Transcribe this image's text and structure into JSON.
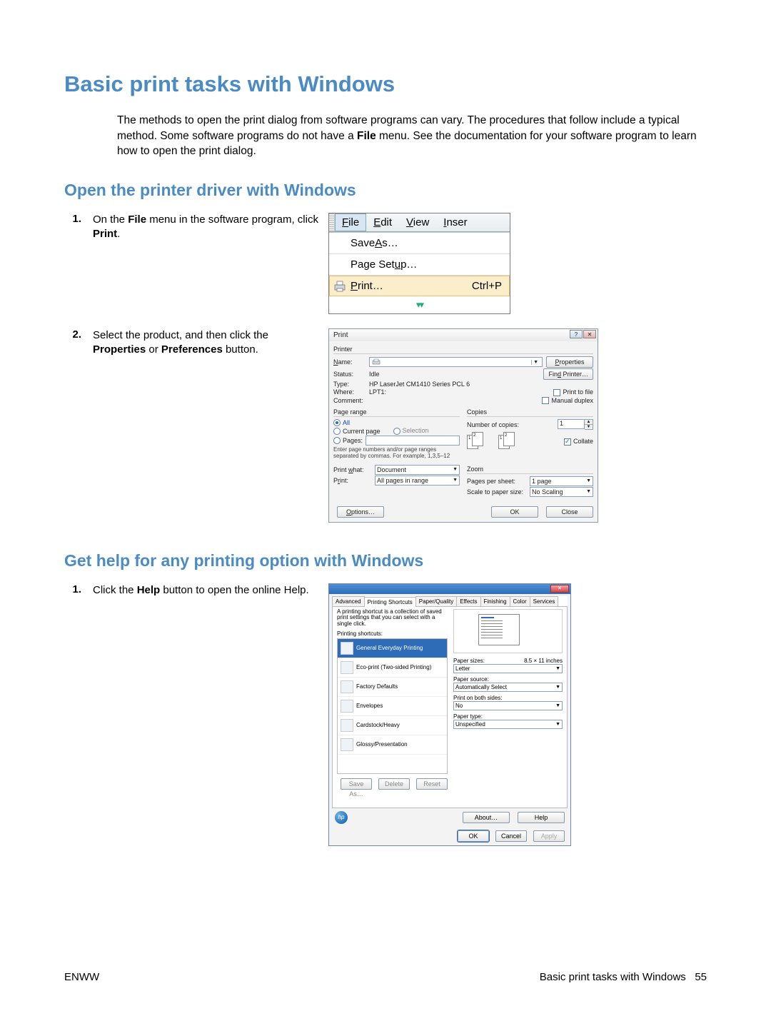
{
  "heading": "Basic print tasks with Windows",
  "intro": {
    "t1": "The methods to open the print dialog from software programs can vary. The procedures that follow include a typical method. Some software programs do not have a ",
    "bold1": "File",
    "t2": " menu. See the documentation for your software program to learn how to open the print dialog."
  },
  "section1": {
    "heading": "Open the printer driver with Windows",
    "step1": {
      "num": "1.",
      "t1": "On the ",
      "b1": "File",
      "t2": " menu in the software program, click ",
      "b2": "Print",
      "t3": "."
    },
    "step2": {
      "num": "2.",
      "t1": "Select the product, and then click the ",
      "b1": "Properties",
      "t2": " or ",
      "b2": "Preferences",
      "t3": " button."
    }
  },
  "section2": {
    "heading": "Get help for any printing option with Windows",
    "step1": {
      "num": "1.",
      "t1": "Click the ",
      "b1": "Help",
      "t2": " button to open the online Help."
    }
  },
  "menubar": {
    "file": "File",
    "edit": "Edit",
    "view": "View",
    "insert": "Inser",
    "saveas": "Save As…",
    "pagesetup": "Page Setup…",
    "print": "Print…",
    "print_accel": "Ctrl+P"
  },
  "printDialog": {
    "title": "Print",
    "printer_group": "Printer",
    "name_label": "Name:",
    "properties_btn": "Properties",
    "findprinter_btn": "Find Printer…",
    "status_label": "Status:",
    "status_val": "Idle",
    "type_label": "Type:",
    "type_val": "HP LaserJet CM1410 Series PCL 6",
    "where_label": "Where:",
    "where_val": "LPT1:",
    "comment_label": "Comment:",
    "printtofile": "Print to file",
    "manualduplex": "Manual duplex",
    "pagerange_group": "Page range",
    "all": "All",
    "currentpage": "Current page",
    "selection": "Selection",
    "pages": "Pages:",
    "pagerange_hint": "Enter page numbers and/or page ranges separated by commas. For example, 1,3,5–12",
    "copies_group": "Copies",
    "numcopies": "Number of copies:",
    "numcopies_val": "1",
    "collate": "Collate",
    "printwhat_label": "Print what:",
    "printwhat_val": "Document",
    "print_label": "Print:",
    "print_val": "All pages in range",
    "zoom_group": "Zoom",
    "pps_label": "Pages per sheet:",
    "pps_val": "1 page",
    "sps_label": "Scale to paper size:",
    "sps_val": "No Scaling",
    "options_btn": "Options…",
    "ok_btn": "OK",
    "close_btn": "Close"
  },
  "propsDialog": {
    "tabs": [
      "Advanced",
      "Printing Shortcuts",
      "Paper/Quality",
      "Effects",
      "Finishing",
      "Color",
      "Services"
    ],
    "active_tab": 1,
    "desc": "A printing shortcut is a collection of saved print settings that you can select with a single click.",
    "shortcuts_label": "Printing shortcuts:",
    "shortcuts": [
      "General Everyday Printing",
      "Eco-print (Two-sided Printing)",
      "Factory Defaults",
      "Envelopes",
      "Cardstock/Heavy",
      "Glossy/Presentation"
    ],
    "selected_shortcut": 0,
    "saveas_btn": "Save As…",
    "delete_btn": "Delete",
    "reset_btn": "Reset",
    "papersizes_label": "Paper sizes:",
    "papersizes_extra": "8.5 × 11 inches",
    "papersizes_val": "Letter",
    "papersource_label": "Paper source:",
    "papersource_val": "Automatically Select",
    "printboth_label": "Print on both sides:",
    "printboth_val": "No",
    "papertype_label": "Paper type:",
    "papertype_val": "Unspecified",
    "about_btn": "About…",
    "help_btn": "Help",
    "ok_btn": "OK",
    "cancel_btn": "Cancel",
    "apply_btn": "Apply"
  },
  "footer": {
    "left": "ENWW",
    "right_text": "Basic print tasks with Windows",
    "page": "55"
  }
}
